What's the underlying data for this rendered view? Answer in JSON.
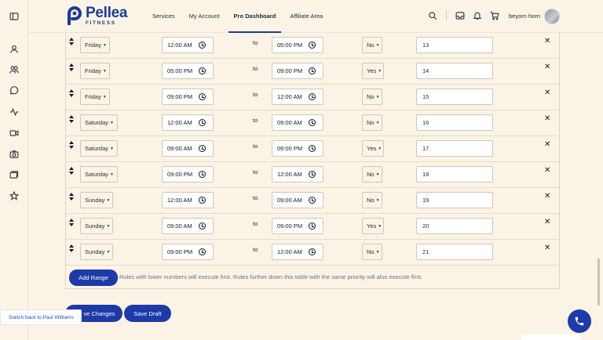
{
  "header": {
    "logo_name": "Pellea",
    "logo_sub": "FITNESS",
    "nav": [
      "Services",
      "My Account",
      "Pro Dashboard",
      "Affiliate Area"
    ],
    "active_nav": "Pro Dashboard",
    "user_name": "beyorn horn"
  },
  "rail_icons": [
    "sidebar-toggle-icon",
    "user-icon",
    "users-icon",
    "chat-icon",
    "activity-icon",
    "video-icon",
    "camera-icon",
    "folders-icon",
    "star-icon"
  ],
  "table": {
    "to_label": "to",
    "rows": [
      {
        "day": "Friday",
        "start": "12:00 AM",
        "end": "05:00 PM",
        "flag": "No",
        "priority": "13"
      },
      {
        "day": "Friday",
        "start": "05:00 PM",
        "end": "09:00 PM",
        "flag": "Yes",
        "priority": "14"
      },
      {
        "day": "Friday",
        "start": "09:00 PM",
        "end": "12:00 AM",
        "flag": "No",
        "priority": "15"
      },
      {
        "day": "Saturday",
        "start": "12:00 AM",
        "end": "09:00 AM",
        "flag": "No",
        "priority": "16"
      },
      {
        "day": "Saturday",
        "start": "09:00 AM",
        "end": "09:00 PM",
        "flag": "Yes",
        "priority": "17"
      },
      {
        "day": "Saturday",
        "start": "09:00 PM",
        "end": "12:00 AM",
        "flag": "No",
        "priority": "18"
      },
      {
        "day": "Sunday",
        "start": "12:00 AM",
        "end": "09:00 AM",
        "flag": "No",
        "priority": "19"
      },
      {
        "day": "Sunday",
        "start": "09:00 AM",
        "end": "09:00 PM",
        "flag": "Yes",
        "priority": "20"
      },
      {
        "day": "Sunday",
        "start": "09:00 PM",
        "end": "12:00 AM",
        "flag": "No",
        "priority": "21"
      }
    ]
  },
  "add_range_label": "Add Range",
  "hint": "Rules with lower numbers will execute first. Rules further down this table with the same priority will also execute first.",
  "save_changes_label": "ve Changes",
  "save_draft_label": "Save Draft",
  "switch_back_label": "Switch back to Paul Williams",
  "accent_color": "#1d3aa8",
  "background_color": "#fbf4e6"
}
